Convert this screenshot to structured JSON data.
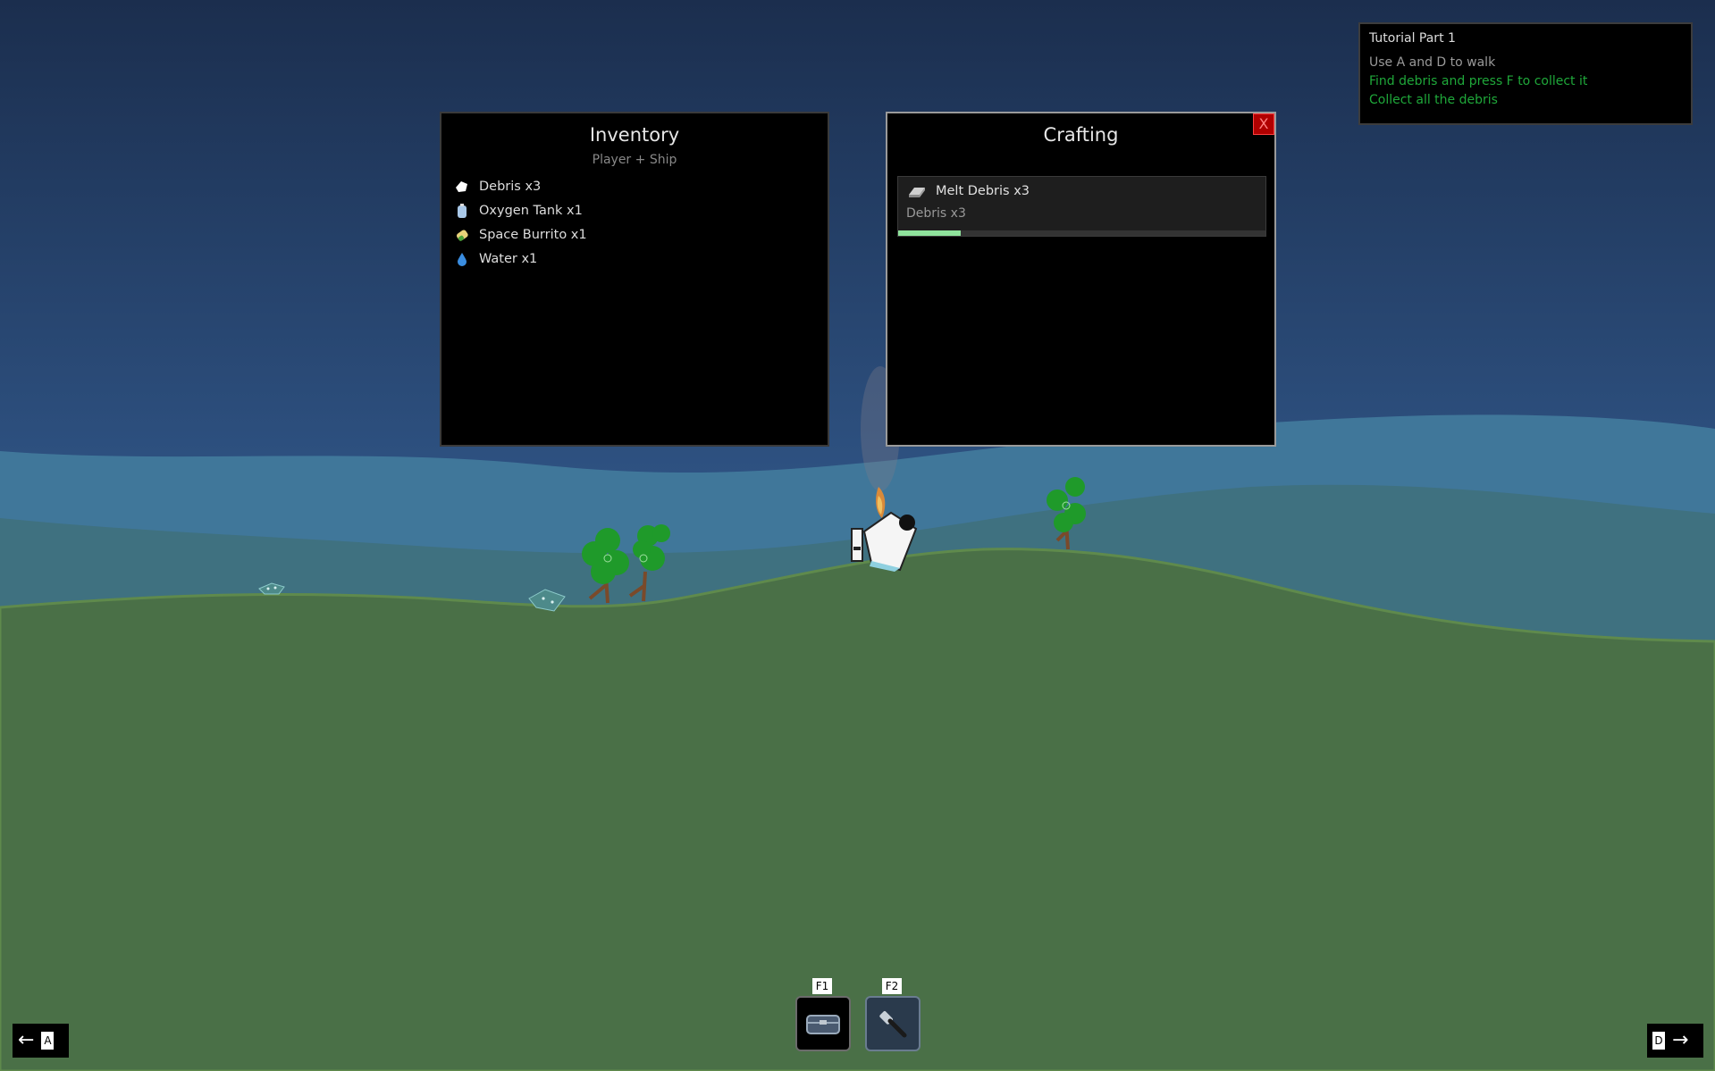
{
  "inventory": {
    "title": "Inventory",
    "subtitle": "Player + Ship",
    "items": [
      {
        "label": "Debris x3",
        "icon": "debris-icon"
      },
      {
        "label": "Oxygen Tank x1",
        "icon": "oxygen-tank-icon"
      },
      {
        "label": "Space Burrito x1",
        "icon": "burrito-icon"
      },
      {
        "label": "Water x1",
        "icon": "water-drop-icon"
      }
    ]
  },
  "crafting": {
    "title": "Crafting",
    "close_label": "X",
    "recipes": [
      {
        "name": "Melt Debris x3",
        "ingredients": "Debris x3",
        "progress": 0.17,
        "icon": "metal-ingot-icon"
      }
    ]
  },
  "tutorial": {
    "title": "Tutorial Part 1",
    "steps": [
      {
        "text": "Use A and D to walk",
        "status": "todo"
      },
      {
        "text": "Find debris and press F to collect it",
        "status": "done"
      },
      {
        "text": "Collect all the debris",
        "status": "done"
      }
    ]
  },
  "controls": {
    "left_key": "A",
    "right_key": "D",
    "left_arrow": "←",
    "right_arrow": "→"
  },
  "hotbar": [
    {
      "key": "F1",
      "icon": "chest-icon",
      "active": false
    },
    {
      "key": "F2",
      "icon": "hammer-icon",
      "active": true
    }
  ],
  "colors": {
    "sky_top": "#1b2e4e",
    "sky_bottom": "#3e6a99",
    "hill_far": "#40779a",
    "hill_mid": "#3f7180",
    "ground": "#4a7047",
    "tutorial_done": "#1fa83a",
    "progress_fill": "#8fe39c"
  }
}
